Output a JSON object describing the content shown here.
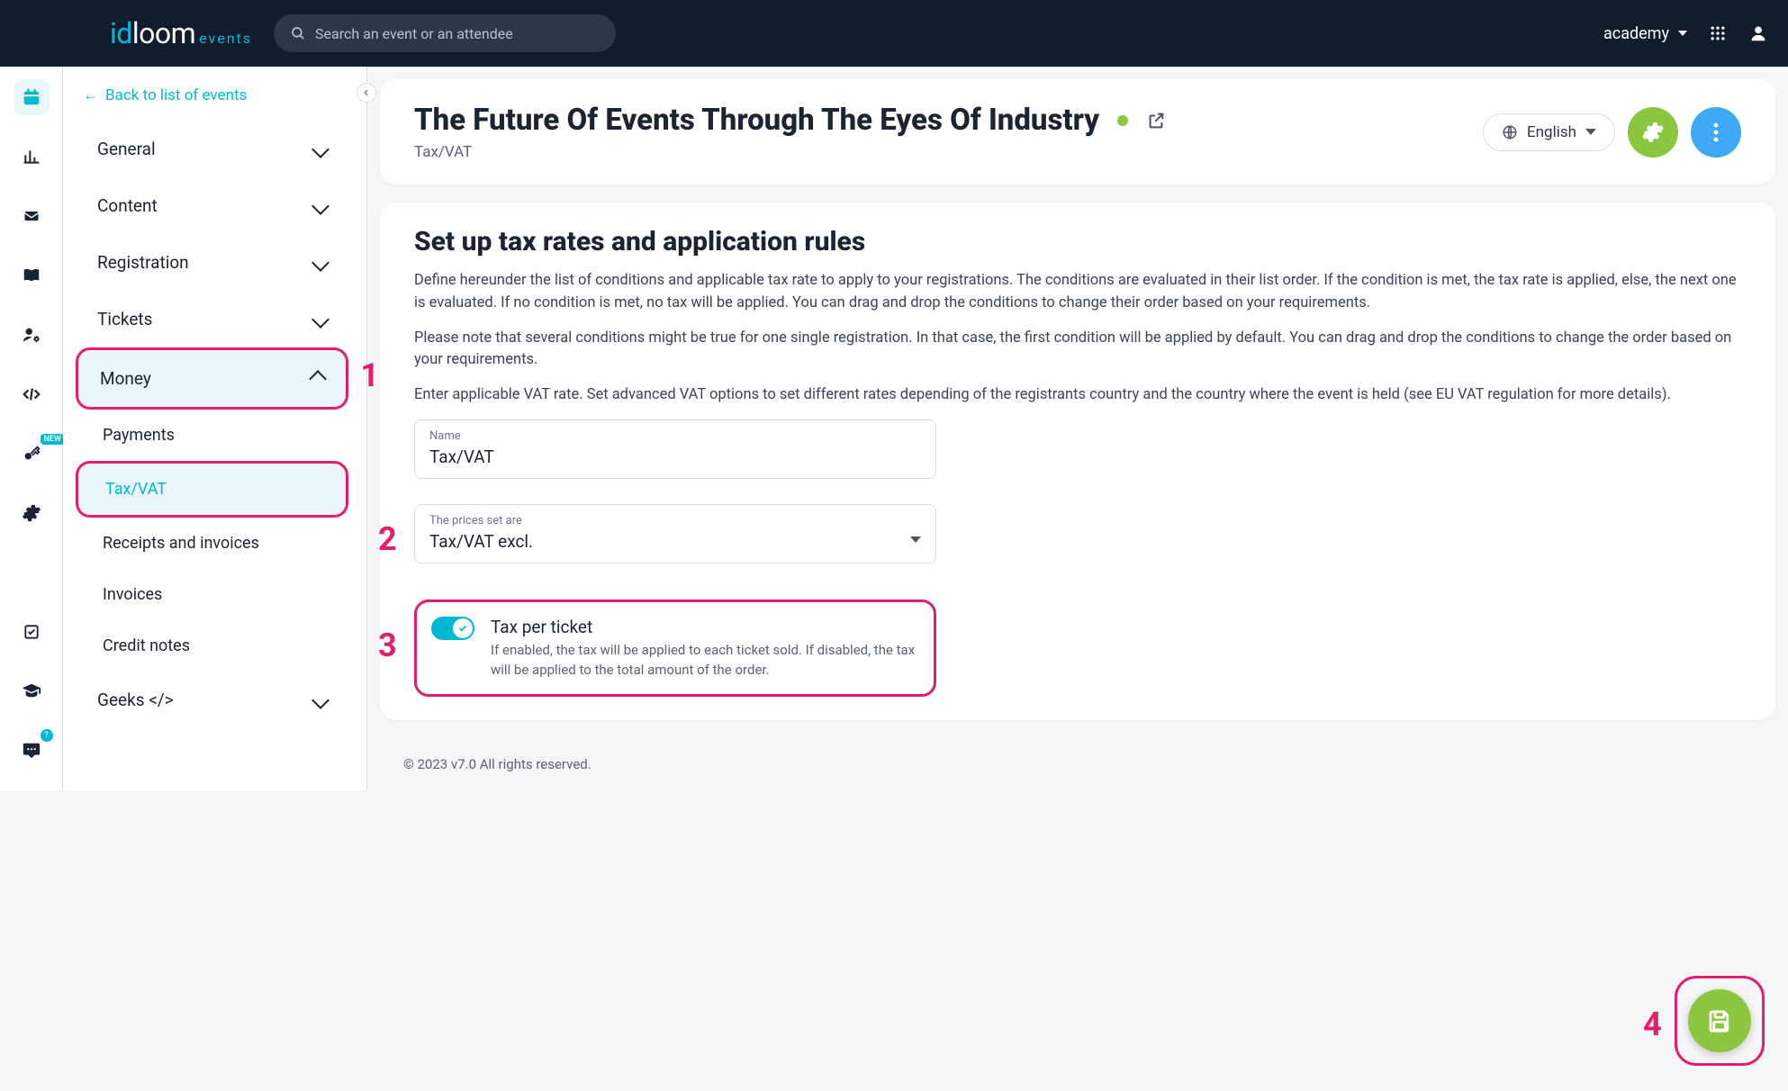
{
  "topbar": {
    "search_placeholder": "Search an event or an attendee",
    "account_label": "academy"
  },
  "logo": {
    "brand_i": "id",
    "brand_d": "loom",
    "brand_ev": "events"
  },
  "sidebar": {
    "back_label": "Back to list of events",
    "items": [
      {
        "label": "General"
      },
      {
        "label": "Content"
      },
      {
        "label": "Registration"
      },
      {
        "label": "Tickets"
      },
      {
        "label": "Money"
      },
      {
        "label": "Geeks </>"
      }
    ],
    "money_children": [
      {
        "label": "Payments"
      },
      {
        "label": "Tax/VAT"
      },
      {
        "label": "Receipts and invoices"
      },
      {
        "label": "Invoices"
      },
      {
        "label": "Credit notes"
      }
    ]
  },
  "page_header": {
    "event_title": "The Future Of Events Through The Eyes Of Industry",
    "breadcrumb": "Tax/VAT",
    "language": "English"
  },
  "section": {
    "heading": "Set up tax rates and application rules",
    "p1": "Define hereunder the list of conditions and applicable tax rate to apply to your registrations. The conditions are evaluated in their list order. If the condition is met, the tax rate is applied, else, the next one is evaluated. If no condition is met, no tax will be applied. You can drag and drop the conditions to change their order based on your requirements.",
    "p2": "Please note that several conditions might be true for one single registration. In that case, the first condition will be applied by default. You can drag and drop the conditions to change the order based on your requirements.",
    "p3": "Enter applicable VAT rate. Set advanced VAT options to set different rates depending of the registrants country and the country where the event is held (see EU VAT regulation for more details)."
  },
  "fields": {
    "name_label": "Name",
    "name_value": "Tax/VAT",
    "prices_label": "The prices set are",
    "prices_value": "Tax/VAT excl."
  },
  "toggle": {
    "title": "Tax per ticket",
    "desc": "If enabled, the tax will be applied to each ticket sold. If disabled, the tax will be applied to the total amount of the order."
  },
  "annotations": {
    "n1": "1",
    "n2": "2",
    "n3": "3",
    "n4": "4"
  },
  "footer": "© 2023 v7.0 All rights reserved.",
  "icons": {
    "rail_new_badge": "NEW"
  }
}
